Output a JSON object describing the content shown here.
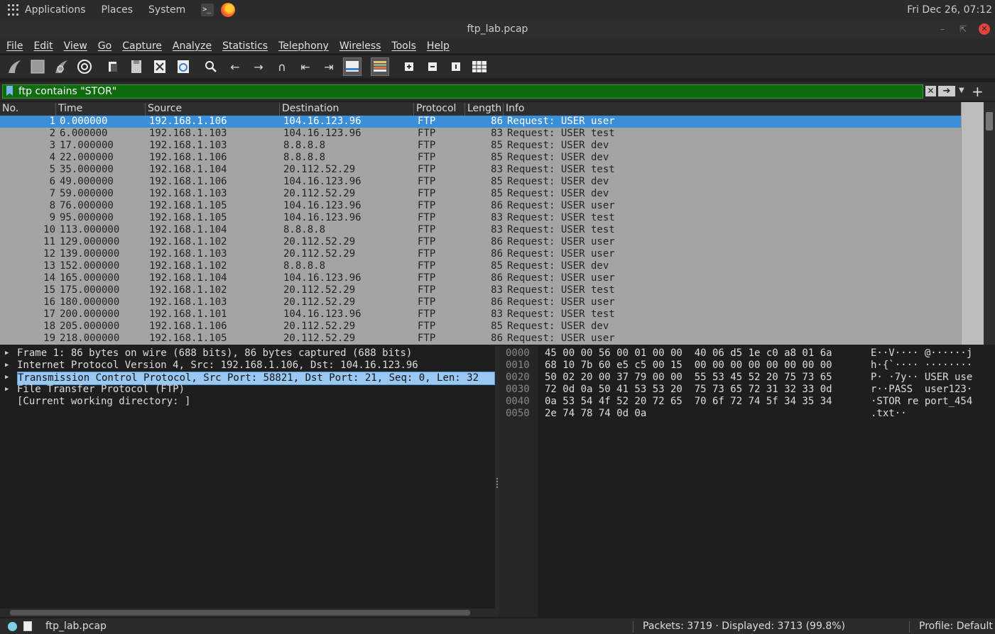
{
  "topbar": {
    "applications": "Applications",
    "places": "Places",
    "system": "System",
    "clock": "Fri Dec 26, 07:12"
  },
  "window": {
    "title": "ftp_lab.pcap"
  },
  "menu": [
    "File",
    "Edit",
    "View",
    "Go",
    "Capture",
    "Analyze",
    "Statistics",
    "Telephony",
    "Wireless",
    "Tools",
    "Help"
  ],
  "toolbar_icons": [
    "shark-fin-start-icon",
    "stop-square-icon",
    "restart-fin-icon",
    "capture-options-gear-icon",
    "open-file-icon",
    "save-file-icon",
    "close-file-icon",
    "reload-icon",
    "find-packet-icon",
    "go-back-icon",
    "go-forward-icon",
    "go-to-packet-icon",
    "first-packet-icon",
    "last-packet-icon",
    "autoscroll-icon",
    "colorize-icon",
    "zoom-in-icon",
    "zoom-out-icon",
    "normal-size-icon",
    "resize-columns-icon"
  ],
  "filter": {
    "value": "ftp contains \"STOR\""
  },
  "packet_list": {
    "columns": [
      "No.",
      "Time",
      "Source",
      "Destination",
      "Protocol",
      "Length",
      "Info"
    ],
    "rows": [
      [
        "1",
        "0.000000",
        "192.168.1.106",
        "104.16.123.96",
        "FTP",
        "86",
        "Request: USER user"
      ],
      [
        "2",
        "6.000000",
        "192.168.1.103",
        "104.16.123.96",
        "FTP",
        "83",
        "Request: USER test"
      ],
      [
        "3",
        "17.000000",
        "192.168.1.103",
        "8.8.8.8",
        "FTP",
        "85",
        "Request: USER dev"
      ],
      [
        "4",
        "22.000000",
        "192.168.1.106",
        "8.8.8.8",
        "FTP",
        "85",
        "Request: USER dev"
      ],
      [
        "5",
        "35.000000",
        "192.168.1.104",
        "20.112.52.29",
        "FTP",
        "83",
        "Request: USER test"
      ],
      [
        "6",
        "49.000000",
        "192.168.1.106",
        "104.16.123.96",
        "FTP",
        "85",
        "Request: USER dev"
      ],
      [
        "7",
        "59.000000",
        "192.168.1.103",
        "20.112.52.29",
        "FTP",
        "85",
        "Request: USER dev"
      ],
      [
        "8",
        "76.000000",
        "192.168.1.105",
        "104.16.123.96",
        "FTP",
        "86",
        "Request: USER user"
      ],
      [
        "9",
        "95.000000",
        "192.168.1.105",
        "104.16.123.96",
        "FTP",
        "83",
        "Request: USER test"
      ],
      [
        "10",
        "113.000000",
        "192.168.1.104",
        "8.8.8.8",
        "FTP",
        "83",
        "Request: USER test"
      ],
      [
        "11",
        "129.000000",
        "192.168.1.102",
        "20.112.52.29",
        "FTP",
        "86",
        "Request: USER user"
      ],
      [
        "12",
        "139.000000",
        "192.168.1.103",
        "20.112.52.29",
        "FTP",
        "86",
        "Request: USER user"
      ],
      [
        "13",
        "152.000000",
        "192.168.1.102",
        "8.8.8.8",
        "FTP",
        "85",
        "Request: USER dev"
      ],
      [
        "14",
        "165.000000",
        "192.168.1.104",
        "104.16.123.96",
        "FTP",
        "86",
        "Request: USER user"
      ],
      [
        "15",
        "175.000000",
        "192.168.1.102",
        "20.112.52.29",
        "FTP",
        "83",
        "Request: USER test"
      ],
      [
        "16",
        "180.000000",
        "192.168.1.103",
        "20.112.52.29",
        "FTP",
        "86",
        "Request: USER user"
      ],
      [
        "17",
        "200.000000",
        "192.168.1.101",
        "104.16.123.96",
        "FTP",
        "83",
        "Request: USER test"
      ],
      [
        "18",
        "205.000000",
        "192.168.1.106",
        "20.112.52.29",
        "FTP",
        "85",
        "Request: USER dev"
      ],
      [
        "19",
        "218.000000",
        "192.168.1.105",
        "20.112.52.29",
        "FTP",
        "86",
        "Request: USER user"
      ]
    ],
    "selected_row": 0
  },
  "details": [
    {
      "text": "Frame 1: 86 bytes on wire (688 bits), 86 bytes captured (688 bits)",
      "expandable": true
    },
    {
      "text": "Internet Protocol Version 4, Src: 192.168.1.106, Dst: 104.16.123.96",
      "expandable": true
    },
    {
      "text": "Transmission Control Protocol, Src Port: 58821, Dst Port: 21, Seq: 0, Len: 32",
      "expandable": true,
      "selected": true
    },
    {
      "text": "File Transfer Protocol (FTP)",
      "expandable": true
    },
    {
      "text": "[Current working directory: ]",
      "expandable": false
    }
  ],
  "bytes": [
    {
      "offset": "0000",
      "hex": "45 00 00 56 00 01 00 00  40 06 d5 1e c0 a8 01 6a",
      "ascii": "E··V···· @······j"
    },
    {
      "offset": "0010",
      "hex": "68 10 7b 60 e5 c5 00 15  00 00 00 00 00 00 00 00",
      "ascii": "h·{`···· ········"
    },
    {
      "offset": "0020",
      "hex": "50 02 20 00 37 79 00 00  55 53 45 52 20 75 73 65",
      "ascii": "P· ·7y·· USER use"
    },
    {
      "offset": "0030",
      "hex": "72 0d 0a 50 41 53 53 20  75 73 65 72 31 32 33 0d",
      "ascii": "r··PASS  user123·"
    },
    {
      "offset": "0040",
      "hex": "0a 53 54 4f 52 20 72 65  70 6f 72 74 5f 34 35 34",
      "ascii": "·STOR re port_454"
    },
    {
      "offset": "0050",
      "hex": "2e 74 78 74 0d 0a",
      "ascii": ".txt··"
    }
  ],
  "status": {
    "file": "ftp_lab.pcap",
    "packets": "Packets: 3719 · Displayed: 3713 (99.8%)",
    "profile": "Profile: Default"
  }
}
